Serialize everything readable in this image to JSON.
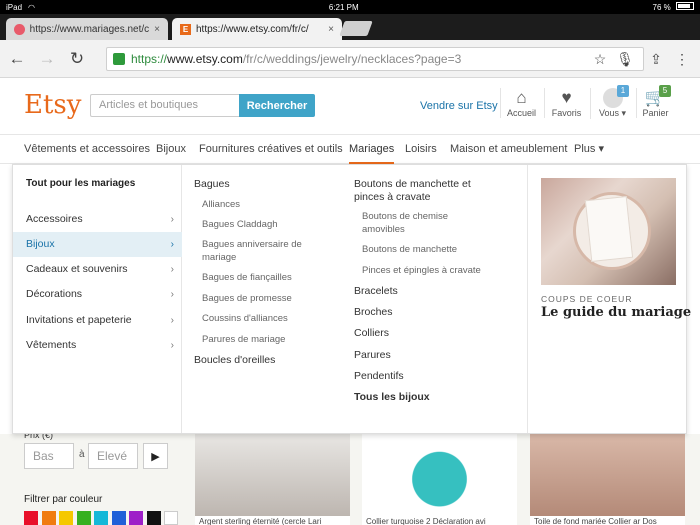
{
  "status_bar": {
    "device": "iPad",
    "time": "6:21 PM",
    "battery": "76 %"
  },
  "tabs": [
    {
      "title": "https://www.mariages.net/c",
      "close": "×"
    },
    {
      "title": "https://www.etsy.com/fr/c/",
      "close": "×"
    }
  ],
  "toolbar": {
    "back_icon": "←",
    "forward_icon": "→",
    "reload_icon": "↻",
    "url_scheme": "https://",
    "url_host": "www.etsy.com",
    "url_path": "/fr/c/weddings/jewelry/necklaces?page=3",
    "star_icon": "☆",
    "mic_icon": "🎙",
    "share_icon": "⇪",
    "menu_icon": "⋮"
  },
  "header": {
    "logo": "Etsy",
    "search_placeholder": "Articles et boutiques",
    "search_button": "Rechercher",
    "sell_link": "Vendre sur Etsy",
    "icons": [
      {
        "label": "Accueil",
        "glyph": "⌂"
      },
      {
        "label": "Favoris",
        "glyph": "♥"
      },
      {
        "label": "Vous",
        "badge": "1"
      },
      {
        "label": "Panier",
        "glyph": "🛒",
        "badge": "5"
      }
    ]
  },
  "categories": [
    "Vêtements et accessoires",
    "Bijoux",
    "Fournitures créatives et outils",
    "Mariages",
    "Loisirs",
    "Maison et ameublement",
    "Plus ▾"
  ],
  "mega": {
    "left_heading": "Tout pour les mariages",
    "left_items": [
      "Accessoires",
      "Bijoux",
      "Cadeaux et souvenirs",
      "Décorations",
      "Invitations et papeterie",
      "Vêtements"
    ],
    "chevron": "›",
    "col1": {
      "heading": "Bagues",
      "subs": [
        "Alliances",
        "Bagues Claddagh",
        "Bagues anniversaire de",
        "mariage",
        "Bagues de fiançailles",
        "Bagues de promesse",
        "Coussins d'alliances",
        "Parures de mariage"
      ],
      "other": "Boucles d'oreilles"
    },
    "col2": {
      "heading_line1": "Boutons de manchette et",
      "heading_line2": "pinces à cravate",
      "subs": [
        "Boutons de chemise",
        "amovibles",
        "Boutons de manchette",
        "Pinces et épingles à cravate"
      ],
      "others": [
        "Bracelets",
        "Broches",
        "Colliers",
        "Parures",
        "Pendentifs"
      ],
      "all": "Tous les bijoux"
    },
    "feature": {
      "kicker": "COUPS DE COEUR",
      "title": "Le guide du mariage"
    }
  },
  "filters": {
    "price_label": "Prix (€)",
    "min_placeholder": "Bas",
    "separator": "à",
    "max_placeholder": "Elevé",
    "go_icon": "▶",
    "color_label": "Filtrer par couleur",
    "swatches": [
      "#e8102a",
      "#f07c10",
      "#f5c800",
      "#36b020",
      "#14b8d8",
      "#2060d8",
      "#9e20c8",
      "#111111",
      "#ffffff"
    ]
  },
  "listings": [
    "Argent sterling éternité (cercle Lari",
    "Collier turquoise 2 Déclaration avi",
    "Toile de fond mariée Collier ar Dos"
  ]
}
